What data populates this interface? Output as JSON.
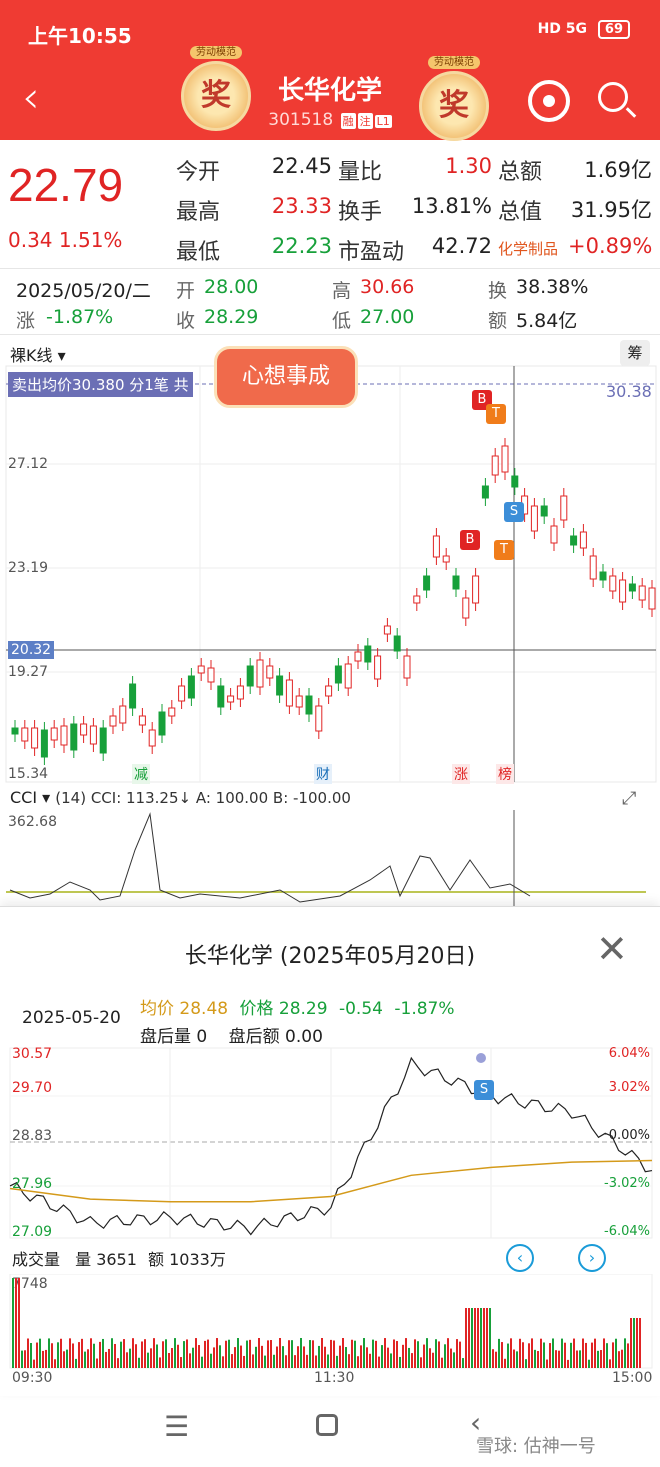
{
  "status": {
    "time": "上午10:55",
    "signal": "HD 5G",
    "battery": "69"
  },
  "header": {
    "title": "长华化学",
    "code": "301518",
    "tags": [
      "融",
      "注",
      "L1"
    ],
    "badge_text": "奖",
    "badge_caption": "劳动模范"
  },
  "quote": {
    "price": "22.79",
    "change": "0.34",
    "change_pct": "1.51%",
    "rows": [
      [
        {
          "l": "今开",
          "v": "22.45",
          "c": "n"
        },
        {
          "l": "量比",
          "v": "1.30",
          "c": "r"
        },
        {
          "l": "总额",
          "v": "1.69亿",
          "c": "n"
        }
      ],
      [
        {
          "l": "最高",
          "v": "23.33",
          "c": "r"
        },
        {
          "l": "换手",
          "v": "13.81%",
          "c": "n"
        },
        {
          "l": "总值",
          "v": "31.95亿",
          "c": "n"
        }
      ],
      [
        {
          "l": "最低",
          "v": "22.23",
          "c": "g"
        },
        {
          "l": "市盈动",
          "v": "42.72",
          "c": "n"
        },
        {
          "l": "化学制品",
          "v": "+0.89%",
          "c": "r"
        }
      ]
    ]
  },
  "day_bar": {
    "date": "2025/05/20/二",
    "open_l": "开",
    "open": "28.00",
    "high_l": "高",
    "high": "30.66",
    "turn_l": "换",
    "turn": "38.38%",
    "chg_l": "涨",
    "chg": "-1.87%",
    "close_l": "收",
    "close": "28.29",
    "low_l": "低",
    "low": "27.00",
    "amt_l": "额",
    "amt": "5.84亿"
  },
  "kchart": {
    "tab": "裸K线",
    "chip": "筹",
    "sell_avg": "卖出均价30.380 分1笔 共",
    "bless": "心想事成",
    "y_labels": [
      "27.12",
      "23.19",
      "19.27",
      "15.34"
    ],
    "right_label": "30.38",
    "cursor_price": "20.32",
    "markers": [
      "减",
      "财",
      "涨",
      "榜"
    ],
    "signals": [
      "B",
      "T",
      "S",
      "B",
      "T"
    ]
  },
  "cci": {
    "name": "CCI",
    "params": "(14) CCI: 113.25↓ A: 100.00 B: -100.00",
    "top": "362.68"
  },
  "popup": {
    "title": "长华化学 (2025年05月20日)",
    "date": "2025-05-20",
    "avg_l": "均价",
    "avg": "28.48",
    "price_l": "价格",
    "price": "28.29",
    "chg": "-0.54",
    "chg_pct": "-1.87%",
    "after_vol": "盘后量 0",
    "after_amt": "盘后额 0.00",
    "y_left": [
      "30.57",
      "29.70",
      "28.83",
      "27.96",
      "27.09"
    ],
    "y_right": [
      "6.04%",
      "3.02%",
      "0.00%",
      "-3.02%",
      "-6.04%"
    ],
    "vol_label": "成交量",
    "vol": "量 3651",
    "amt": "额 1033万",
    "vol_max": "7748",
    "times": [
      "09:30",
      "11:30",
      "15:00"
    ],
    "signal": "S"
  },
  "watermark": "雪球: 估神一号",
  "chart_data": {
    "type": "line",
    "title": "长华化学 (2025年05月20日)",
    "xlabel": "",
    "ylabel": "",
    "ylim": [
      27.09,
      30.57
    ],
    "x": [
      "09:30",
      "10:00",
      "10:30",
      "11:00",
      "11:30",
      "13:30",
      "14:00",
      "14:30",
      "15:00"
    ],
    "series": [
      {
        "name": "价格",
        "values": [
          28.0,
          27.3,
          27.4,
          27.2,
          27.6,
          30.3,
          29.7,
          29.4,
          28.29
        ]
      },
      {
        "name": "均价",
        "values": [
          27.95,
          27.75,
          27.7,
          27.7,
          27.8,
          28.2,
          28.35,
          28.45,
          28.48
        ]
      }
    ]
  }
}
